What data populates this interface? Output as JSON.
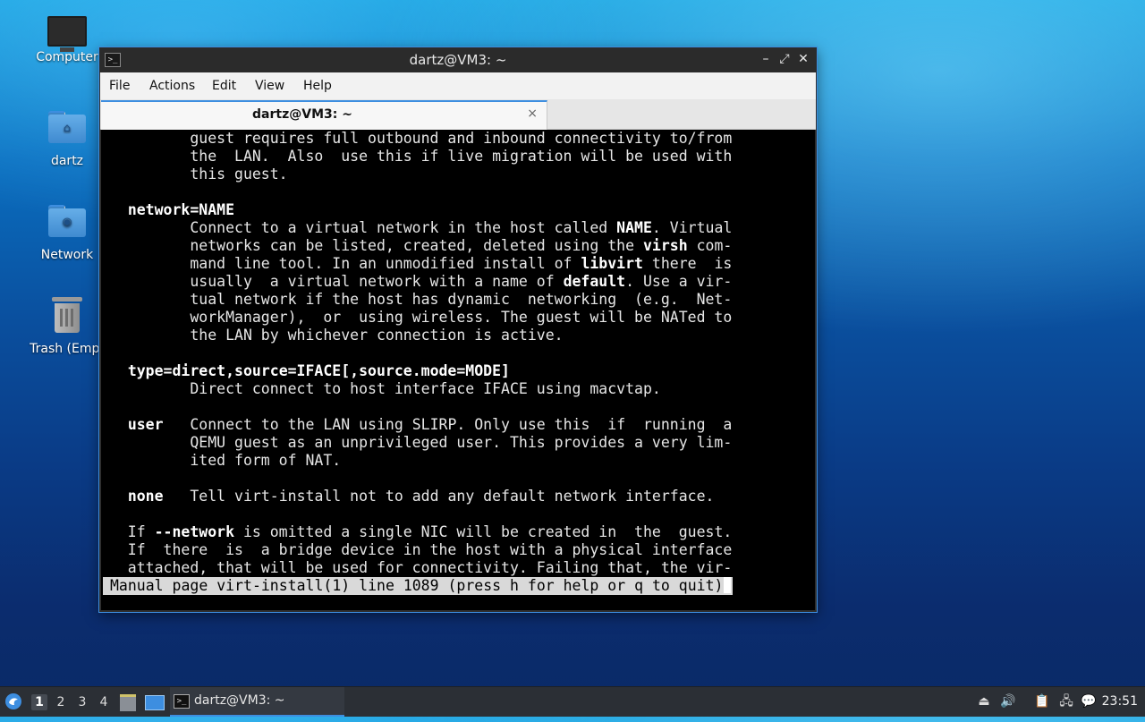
{
  "desktop": {
    "icons": [
      {
        "label": "Computer",
        "icon": "computer-icon"
      },
      {
        "label": "dartz",
        "icon": "home-folder-icon"
      },
      {
        "label": "Network",
        "icon": "network-folder-icon"
      },
      {
        "label": "Trash (Empt",
        "icon": "trash-icon"
      }
    ]
  },
  "window": {
    "title": "dartz@VM3: ~",
    "controls": {
      "minimize": "–",
      "maximize": "⤢",
      "close": "✕"
    },
    "menu": [
      "File",
      "Actions",
      "Edit",
      "View",
      "Help"
    ],
    "tab": {
      "label": "dartz@VM3: ~",
      "close": "×"
    },
    "terminal": {
      "lines": [
        "          guest requires full outbound and inbound connectivity to/from",
        "          the  LAN.  Also  use this if live migration will be used with",
        "          this guest.",
        "",
        "   network=NAME",
        "          Connect to a virtual network in the host called NAME. Virtual",
        "          networks can be listed, created, deleted using the virsh com-",
        "          mand line tool. In an unmodified install of libvirt there  is",
        "          usually  a virtual network with a name of default. Use a vir-",
        "          tual network if the host has dynamic  networking  (e.g.  Net-",
        "          workManager),  or  using wireless. The guest will be NATed to",
        "          the LAN by whichever connection is active.",
        "",
        "   type=direct,source=IFACE[,source.mode=MODE]",
        "          Direct connect to host interface IFACE using macvtap.",
        "",
        "   user   Connect to the LAN using SLIRP. Only use this  if  running  a",
        "          QEMU guest as an unprivileged user. This provides a very lim-",
        "          ited form of NAT.",
        "",
        "   none   Tell virt-install not to add any default network interface.",
        "",
        "   If --network is omitted a single NIC will be created in  the  guest.",
        "   If  there  is  a bridge device in the host with a physical interface",
        "   attached, that will be used for connectivity. Failing that, the vir-"
      ],
      "status": "Manual page virt-install(1) line 1089 (press h for help or q to quit)"
    }
  },
  "taskbar": {
    "workspaces": [
      "1",
      "2",
      "3",
      "4"
    ],
    "active_workspace": "1",
    "task_label": "dartz@VM3: ~",
    "clock": "23:51"
  },
  "colors": {
    "accent": "#3d8ee0",
    "terminal_bg": "#000000",
    "status_bg": "#d9d9d9"
  }
}
